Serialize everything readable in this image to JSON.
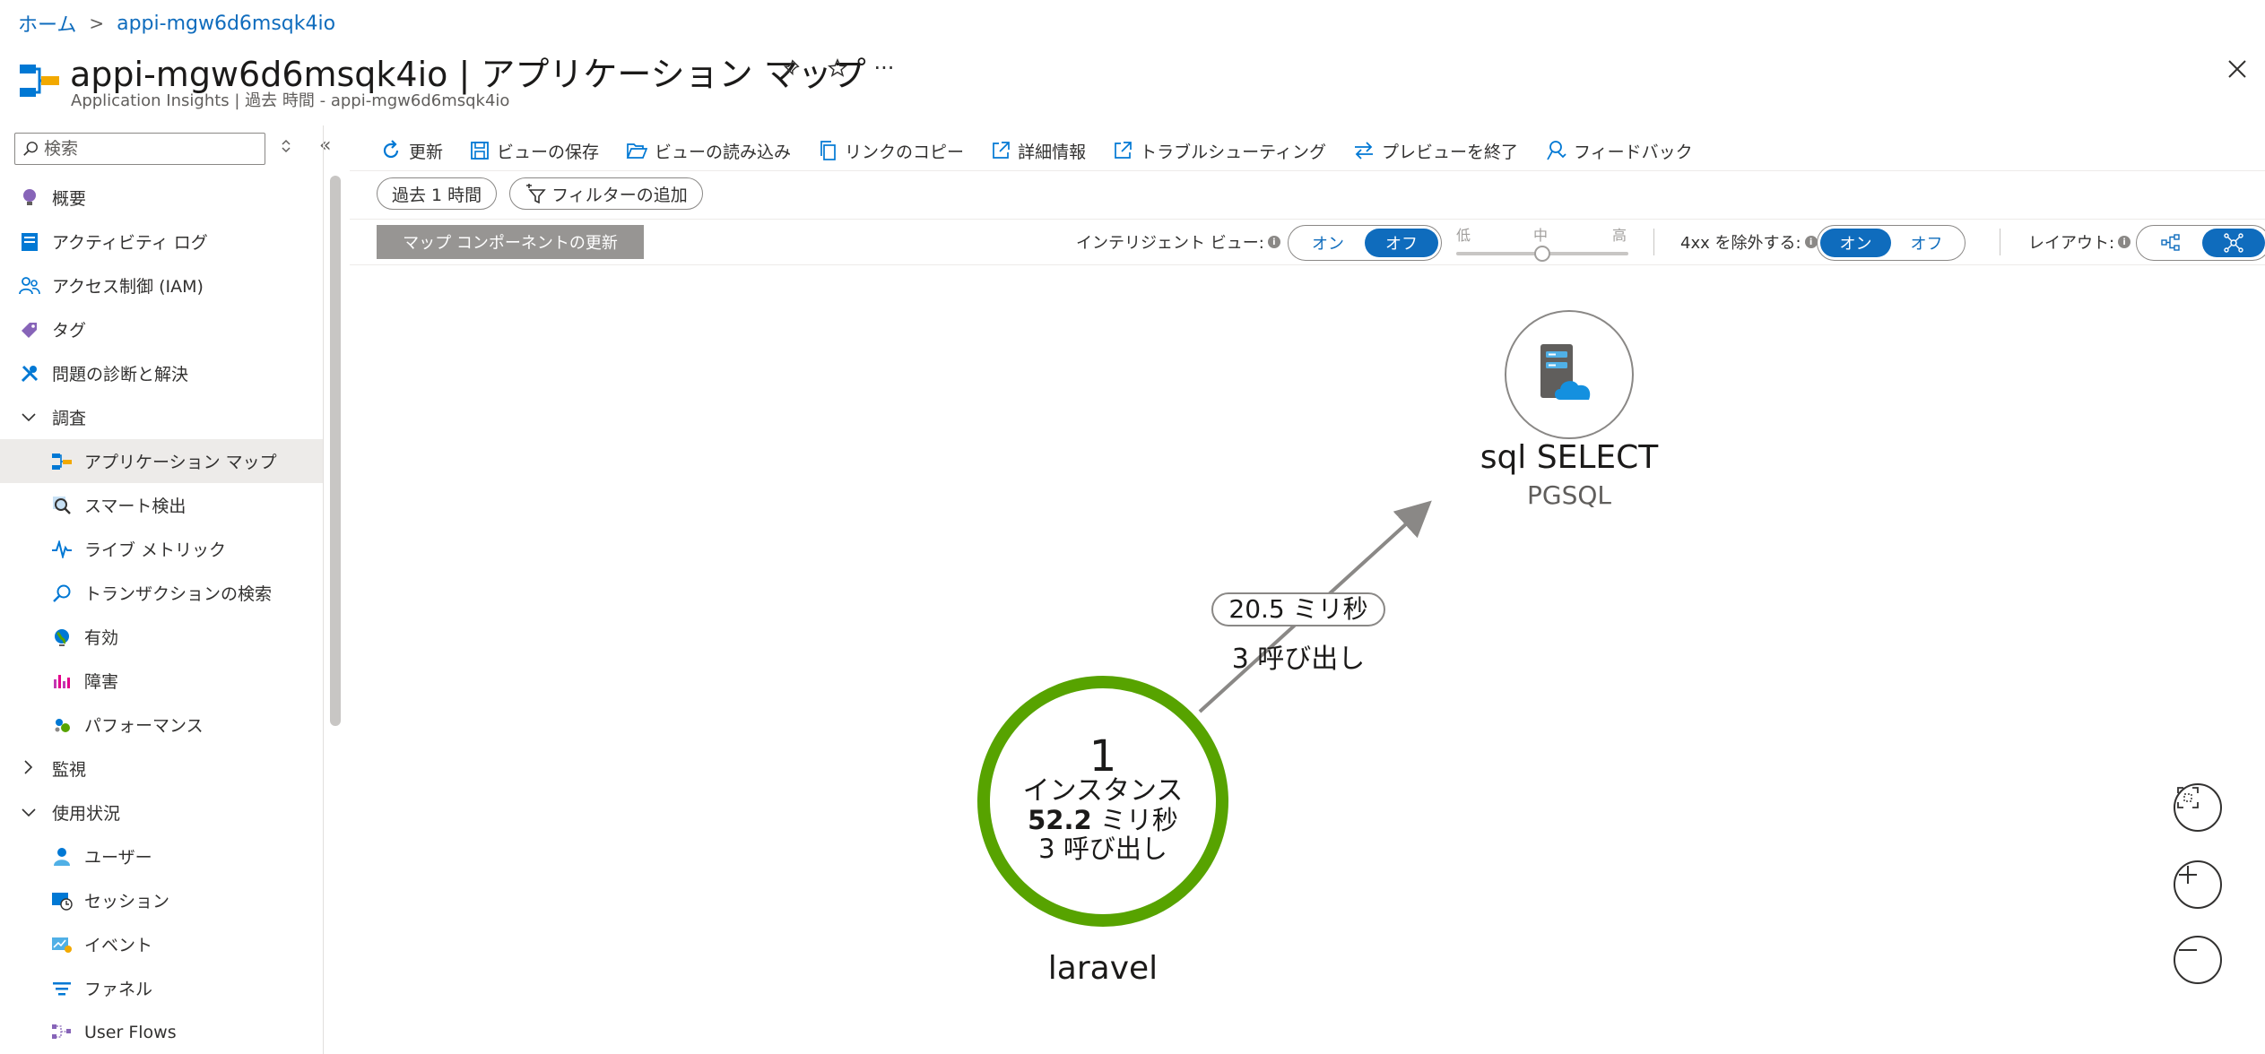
{
  "breadcrumb": {
    "home": "ホーム",
    "current": "appi-mgw6d6msqk4io"
  },
  "header": {
    "title": "appi-mgw6d6msqk4io | アプリケーション マップ",
    "subtitle": "Application Insights | 過去 時間 - appi-mgw6d6msqk4io",
    "more": "···"
  },
  "sidebar": {
    "search_placeholder": "検索",
    "collapse": "«",
    "items": [
      {
        "label": "概要",
        "icon": "lightbulb-icon"
      },
      {
        "label": "アクティビティ ログ",
        "icon": "activity-log-icon"
      },
      {
        "label": "アクセス制御 (IAM)",
        "icon": "people-icon"
      },
      {
        "label": "タグ",
        "icon": "tag-icon"
      },
      {
        "label": "問題の診断と解決",
        "icon": "wrench-icon"
      },
      {
        "label": "調査",
        "icon": "chevron-down-icon"
      },
      {
        "label": "アプリケーション マップ",
        "icon": "app-map-icon"
      },
      {
        "label": "スマート検出",
        "icon": "smart-detection-icon"
      },
      {
        "label": "ライブ メトリック",
        "icon": "pulse-icon"
      },
      {
        "label": "トランザクションの検索",
        "icon": "search-icon"
      },
      {
        "label": "有効",
        "icon": "globe-icon"
      },
      {
        "label": "障害",
        "icon": "failures-icon"
      },
      {
        "label": "パフォーマンス",
        "icon": "performance-icon"
      },
      {
        "label": "監視",
        "icon": "chevron-right-icon"
      },
      {
        "label": "使用状況",
        "icon": "chevron-down-icon"
      },
      {
        "label": "ユーザー",
        "icon": "user-icon"
      },
      {
        "label": "セッション",
        "icon": "sessions-icon"
      },
      {
        "label": "イベント",
        "icon": "events-icon"
      },
      {
        "label": "ファネル",
        "icon": "funnel-icon"
      },
      {
        "label": "User Flows",
        "icon": "user-flows-icon"
      }
    ]
  },
  "toolbar": {
    "refresh": "更新",
    "save_view": "ビューの保存",
    "load_view": "ビューの読み込み",
    "copy_link": "リンクのコピー",
    "details": "詳細情報",
    "troubleshoot": "トラブルシューティング",
    "exit_preview": "プレビューを終了",
    "feedback": "フィードバック"
  },
  "filters": {
    "time_range": "過去 1 時間",
    "add_filter": "フィルターの追加"
  },
  "controls": {
    "update_components": "マップ コンポーネントの更新",
    "intelligent_view": "インテリジェント ビュー:",
    "on": "オン",
    "off": "オフ",
    "intelligent_view_state": "off",
    "slider_low": "低",
    "slider_mid": "中",
    "slider_high": "高",
    "slider_level": 0.5,
    "exclude_4xx": "4xx を除外する:",
    "exclude_4xx_state": "on",
    "layout": "レイアウト:",
    "layout_state": "force"
  },
  "map": {
    "nodes": [
      {
        "name": "laravel",
        "instances": "1",
        "instances_label": "インスタンス",
        "duration": "52.2",
        "duration_unit": "ミリ秒",
        "calls": "3 呼び出し",
        "ring_color": "#57a300"
      },
      {
        "name": "sql SELECT",
        "type": "PGSQL",
        "icon": "sql-database-icon"
      }
    ],
    "edge": {
      "duration": "20.5 ミリ秒",
      "calls": "3 呼び出し",
      "color": "#8a8886"
    }
  },
  "colors": {
    "accent": "#0f6cbd",
    "healthy": "#57a300"
  }
}
